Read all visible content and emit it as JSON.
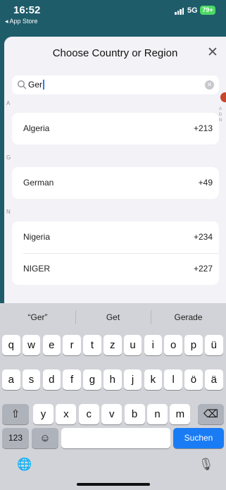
{
  "status_bar": {
    "time": "16:52",
    "back_label": "◂ App Store",
    "network": "5G",
    "battery": "79+"
  },
  "sheet": {
    "title": "Choose Country or Region",
    "close_glyph": "✕"
  },
  "search": {
    "value": "Ger",
    "clear_glyph": "✕"
  },
  "sections": [
    {
      "letter": "A",
      "rows": [
        {
          "name": "Algeria",
          "code": "+213"
        }
      ]
    },
    {
      "letter": "G",
      "rows": [
        {
          "name": "German",
          "code": "+49"
        }
      ]
    },
    {
      "letter": "N",
      "rows": [
        {
          "name": "Nigeria",
          "code": "+234"
        },
        {
          "name": "NIGER",
          "code": "+227"
        }
      ]
    }
  ],
  "index": {
    "letters": [
      "A",
      "G",
      "N"
    ]
  },
  "keyboard": {
    "suggestions": [
      "“Ger”",
      "Get",
      "Gerade"
    ],
    "row1": [
      "q",
      "w",
      "e",
      "r",
      "t",
      "z",
      "u",
      "i",
      "o",
      "p",
      "ü"
    ],
    "row2": [
      "a",
      "s",
      "d",
      "f",
      "g",
      "h",
      "j",
      "k",
      "l",
      "ö",
      "ä"
    ],
    "row3": [
      "y",
      "x",
      "c",
      "v",
      "b",
      "n",
      "m"
    ],
    "shift_glyph": "⇧",
    "delete_glyph": "⌫",
    "numbers_label": "123",
    "emoji_glyph": "☺",
    "space_label": "",
    "return_label": "Suchen",
    "globe_glyph": "🌐",
    "mic_glyph": "🎙"
  },
  "colors": {
    "accent": "#1a7cf5",
    "status_bg": "#1f5c6a",
    "battery": "#4cd964"
  }
}
